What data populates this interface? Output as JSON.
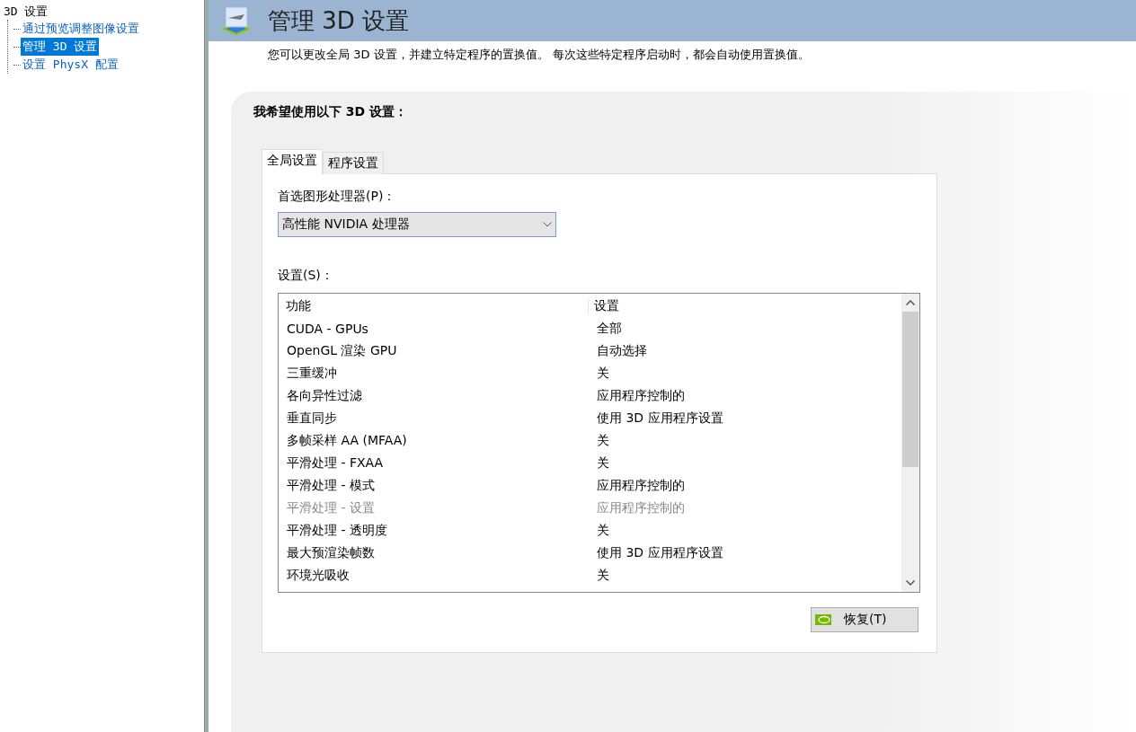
{
  "tree": {
    "label": "3D 设置",
    "children": [
      {
        "label": "通过预览调整图像设置",
        "selected": false
      },
      {
        "label": "管理 3D 设置",
        "selected": true
      },
      {
        "label": "设置 PhysX 配置",
        "selected": false
      }
    ]
  },
  "header": {
    "title": "管理 3D 设置"
  },
  "description": "您可以更改全局 3D 设置，并建立特定程序的置换值。 每次这些特定程序启动时，都会自动使用置换值。",
  "section_title": "我希望使用以下 3D 设置：",
  "tabs": [
    {
      "label": "全局设置",
      "selected": true
    },
    {
      "label": "程序设置",
      "selected": false
    }
  ],
  "processor": {
    "label": "首选图形处理器(P)：",
    "value": "高性能 NVIDIA 处理器"
  },
  "settings": {
    "label": "设置(S)：",
    "columns": [
      "功能",
      "设置"
    ],
    "rows": [
      {
        "feature": "CUDA - GPUs",
        "value": "全部",
        "disabled": false
      },
      {
        "feature": "OpenGL 渲染 GPU",
        "value": "自动选择",
        "disabled": false
      },
      {
        "feature": "三重缓冲",
        "value": "关",
        "disabled": false
      },
      {
        "feature": "各向异性过滤",
        "value": "应用程序控制的",
        "disabled": false
      },
      {
        "feature": "垂直同步",
        "value": "使用 3D 应用程序设置",
        "disabled": false
      },
      {
        "feature": "多帧采样 AA (MFAA)",
        "value": "关",
        "disabled": false
      },
      {
        "feature": "平滑处理 - FXAA",
        "value": "关",
        "disabled": false
      },
      {
        "feature": "平滑处理 - 模式",
        "value": "应用程序控制的",
        "disabled": false
      },
      {
        "feature": "平滑处理 - 设置",
        "value": "应用程序控制的",
        "disabled": true
      },
      {
        "feature": "平滑处理 - 透明度",
        "value": "关",
        "disabled": false
      },
      {
        "feature": "最大预渲染帧数",
        "value": "使用 3D 应用程序设置",
        "disabled": false
      },
      {
        "feature": "环境光吸收",
        "value": "关",
        "disabled": false
      }
    ]
  },
  "restore_button": "恢复(T)"
}
